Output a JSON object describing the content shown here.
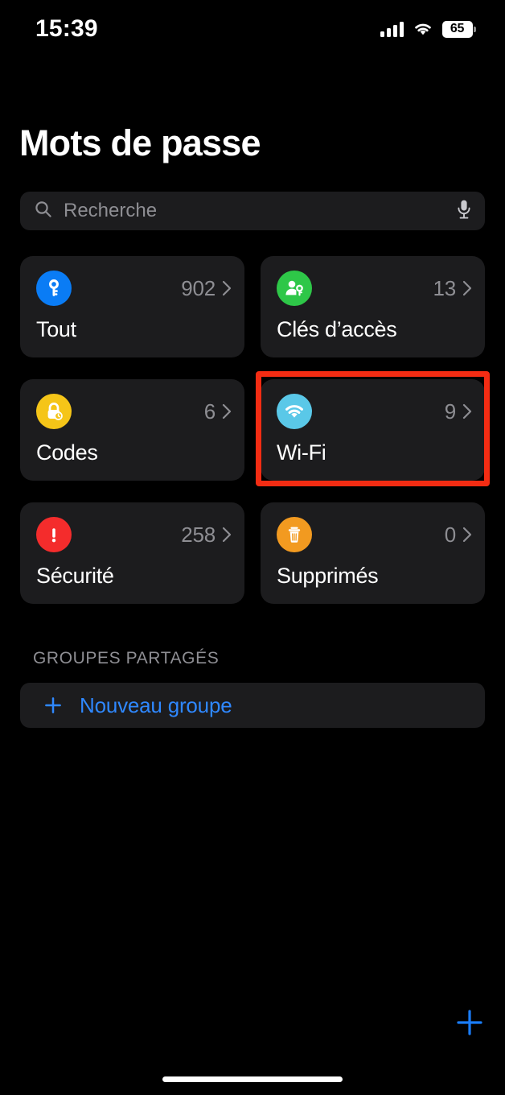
{
  "status_bar": {
    "time": "15:39",
    "battery_level": "65",
    "cellular_icon": "cellular-bars-icon",
    "wifi_icon": "wifi-icon",
    "battery_icon": "battery-icon"
  },
  "header": {
    "title": "Mots de passe"
  },
  "search": {
    "placeholder": "Recherche",
    "value": "",
    "search_icon": "search-icon",
    "mic_icon": "microphone-icon"
  },
  "categories": [
    {
      "label": "Tout",
      "count": "902",
      "icon": "key-icon",
      "icon_color": "#0a7cf5",
      "highlighted": false
    },
    {
      "label": "Clés d’accès",
      "count": "13",
      "icon": "person-key-icon",
      "icon_color": "#2ec748",
      "highlighted": false
    },
    {
      "label": "Codes",
      "count": "6",
      "icon": "lock-clock-icon",
      "icon_color": "#f5c518",
      "highlighted": false
    },
    {
      "label": "Wi-Fi",
      "count": "9",
      "icon": "wifi-icon",
      "icon_color": "#5ac8e8",
      "highlighted": true
    },
    {
      "label": "Sécurité",
      "count": "258",
      "icon": "exclamation-icon",
      "icon_color": "#f42c2c",
      "highlighted": false
    },
    {
      "label": "Supprimés",
      "count": "0",
      "icon": "trash-icon",
      "icon_color": "#f29a20",
      "highlighted": false
    }
  ],
  "shared_groups": {
    "section_label": "GROUPES PARTAGÉS",
    "new_group_label": "Nouveau groupe",
    "plus_icon": "plus-icon"
  },
  "add_button": {
    "icon": "plus-icon",
    "color": "#0a7cf5"
  },
  "annotation": {
    "highlight_color": "#f32c13",
    "target": "Wi-Fi"
  },
  "colors": {
    "background": "#000000",
    "card_background": "#1c1c1e",
    "accent_blue": "#2f88ff",
    "secondary_text": "#8e8e93"
  }
}
